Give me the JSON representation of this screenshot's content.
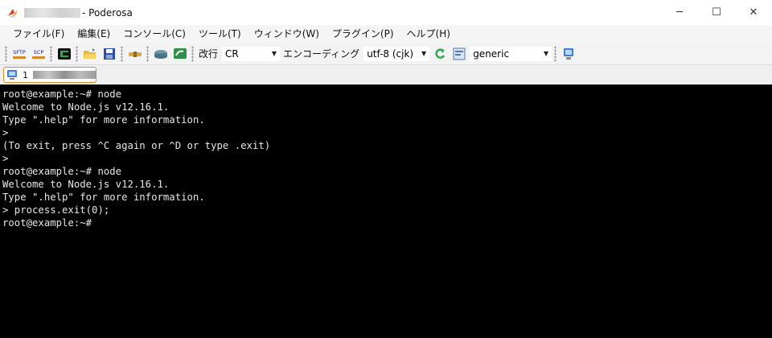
{
  "window": {
    "title": "- Poderosa",
    "controls": {
      "minimize": "─",
      "maximize": "☐",
      "close": "✕"
    }
  },
  "menu": {
    "items": [
      {
        "label": "ファイル(F)"
      },
      {
        "label": "編集(E)"
      },
      {
        "label": "コンソール(C)"
      },
      {
        "label": "ツール(T)"
      },
      {
        "label": "ウィンドウ(W)"
      },
      {
        "label": "プラグイン(P)"
      },
      {
        "label": "ヘルプ(H)"
      }
    ]
  },
  "toolbar": {
    "sftp_label": "SFTP",
    "scp_label": "SCP",
    "newline_label": "改行",
    "newline_value": "CR",
    "encoding_label": "エンコーディング",
    "encoding_value": "utf-8 (cjk)",
    "terminal_type_value": "generic"
  },
  "tabs": [
    {
      "number": "1"
    }
  ],
  "terminal": {
    "lines": [
      "root@example:~# node",
      "Welcome to Node.js v12.16.1.",
      "Type \".help\" for more information.",
      ">",
      "(To exit, press ^C again or ^D or type .exit)",
      ">",
      "root@example:~# node",
      "Welcome to Node.js v12.16.1.",
      "Type \".help\" for more information.",
      "> process.exit(0);",
      "root@example:~#"
    ]
  },
  "colors": {
    "terminal_bg": "#000000",
    "terminal_fg": "#e6e6e6",
    "tab_border": "#d98a2b"
  }
}
